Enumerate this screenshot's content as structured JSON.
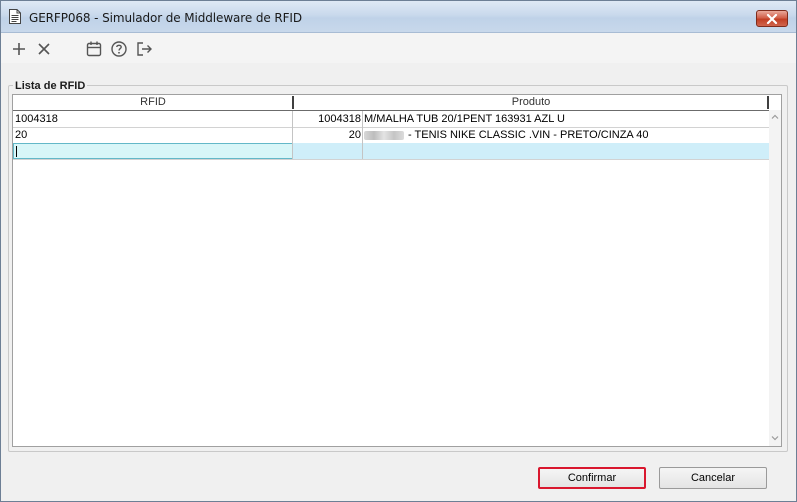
{
  "window": {
    "title": "GERFP068 - Simulador de Middleware de RFID"
  },
  "toolbar": {
    "icons": [
      "plus-icon",
      "close-x-icon",
      "calendar-icon",
      "help-icon",
      "exit-icon"
    ]
  },
  "group": {
    "label": "Lista de RFID"
  },
  "grid": {
    "columns": [
      "RFID",
      "Produto"
    ],
    "rows": [
      {
        "rfid": "1004318",
        "code": "1004318",
        "produto": "M/MALHA TUB 20/1PENT 163931 AZL U"
      },
      {
        "rfid": "20",
        "code": "20",
        "produto": "- TENIS NIKE CLASSIC .VIN - PRETO/CINZA 40"
      }
    ],
    "new_row": {
      "rfid": "",
      "code": "",
      "produto": ""
    }
  },
  "buttons": {
    "confirm": "Confirmar",
    "cancel": "Cancelar"
  },
  "colors": {
    "titlebar": "#c9d9ec",
    "close": "#c23f24",
    "new_row": "#cfeef9",
    "default_button_border": "#d9172e"
  }
}
